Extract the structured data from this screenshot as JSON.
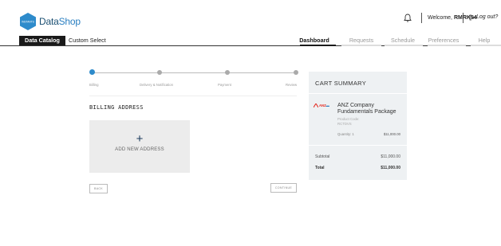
{
  "header": {
    "logo_badge": "INSTANTS",
    "logo_name_a": "Data",
    "logo_name_b": "Shop",
    "welcome_prefix": "Welcome, ",
    "username": "RMRK54",
    "logout_label": "Log out?"
  },
  "nav": {
    "left_tabs": [
      "Data Catalog",
      "Custom Select"
    ],
    "right_tabs": [
      "Dashboard",
      "Requests",
      "Schedule",
      "Preferences",
      "Help"
    ],
    "active_right": "Dashboard"
  },
  "steps": {
    "labels": [
      "Billing",
      "Delivery & Notification",
      "Payment",
      "Review"
    ],
    "current_index": 0
  },
  "billing": {
    "title": "BILLING ADDRESS",
    "add_icon": "+",
    "add_label": "ADD NEW ADDRESS"
  },
  "buttons": {
    "back": "BACK",
    "continue": "CONTINUE"
  },
  "cart": {
    "title": "CART SUMMARY",
    "brand_logo": "ANZ",
    "product_name": "ANZ Company Fundamentals Package",
    "product_code_label": "Product Code:",
    "product_code": "RCTDVS",
    "quantity": "Quantity: 1",
    "line_price": "$11,000.00",
    "subtotal_label": "Subtotal",
    "subtotal_value": "$11,000.00",
    "total_label": "Total",
    "total_value": "$11,000.00"
  },
  "colors": {
    "accent": "#2e8bcb",
    "brand_dark": "#1b4f72",
    "nav_active_bg": "#1a1a1a",
    "brand_red": "#e4251b"
  }
}
